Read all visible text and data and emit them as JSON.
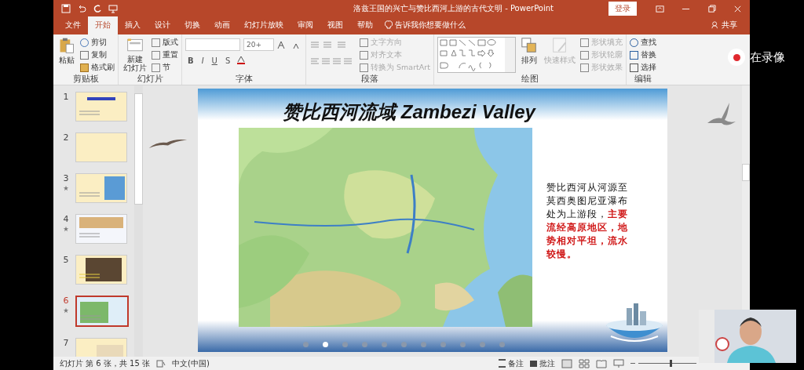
{
  "window": {
    "title": "洛兹王国的兴亡与赞比西河上游的古代文明 - PowerPoint",
    "login": "登录"
  },
  "tabs": [
    {
      "label": "文件",
      "selected": false
    },
    {
      "label": "开始",
      "selected": true
    },
    {
      "label": "插入",
      "selected": false
    },
    {
      "label": "设计",
      "selected": false
    },
    {
      "label": "切换",
      "selected": false
    },
    {
      "label": "动画",
      "selected": false
    },
    {
      "label": "幻灯片放映",
      "selected": false
    },
    {
      "label": "审阅",
      "selected": false
    },
    {
      "label": "视图",
      "selected": false
    },
    {
      "label": "帮助",
      "selected": false
    }
  ],
  "tell_me": "告诉我你想要做什么",
  "share": "共享",
  "ribbon": {
    "clipboard": {
      "label": "剪贴板",
      "paste": "粘贴",
      "items": [
        {
          "label": "剪切",
          "disabled": false
        },
        {
          "label": "复制",
          "disabled": false
        },
        {
          "label": "格式刷",
          "disabled": false
        }
      ]
    },
    "slides": {
      "label": "幻灯片",
      "new_slide": [
        "新建",
        "幻灯片"
      ],
      "items": [
        {
          "label": "版式",
          "disabled": false
        },
        {
          "label": "重置",
          "disabled": false
        },
        {
          "label": "节",
          "disabled": false
        }
      ]
    },
    "font": {
      "label": "字体",
      "size": "20+",
      "format_buttons": [
        "B",
        "I",
        "U",
        "S"
      ]
    },
    "paragraph": {
      "label": "段落",
      "items": [
        {
          "label": "文字方向",
          "disabled": true
        },
        {
          "label": "对齐文本",
          "disabled": true
        },
        {
          "label": "转换为 SmartArt",
          "disabled": true
        }
      ]
    },
    "drawing": {
      "label": "绘图",
      "arrange": {
        "label": "排列",
        "disabled": false
      },
      "quick_styles": {
        "label": "快速样式",
        "disabled": true
      },
      "items": [
        {
          "label": "形状填充",
          "disabled": true
        },
        {
          "label": "形状轮廓",
          "disabled": true
        },
        {
          "label": "形状效果",
          "disabled": true
        }
      ]
    },
    "editing": {
      "label": "编辑",
      "items": [
        {
          "label": "查找",
          "disabled": false
        },
        {
          "label": "替换",
          "disabled": false
        },
        {
          "label": "选择",
          "disabled": false
        }
      ]
    }
  },
  "slide_pane": [
    {
      "number": "1",
      "animated": false,
      "selected": false
    },
    {
      "number": "2",
      "animated": false,
      "selected": false
    },
    {
      "number": "3",
      "animated": true,
      "selected": false
    },
    {
      "number": "4",
      "animated": true,
      "selected": false
    },
    {
      "number": "5",
      "animated": false,
      "selected": false
    },
    {
      "number": "6",
      "animated": true,
      "selected": true
    },
    {
      "number": "7",
      "animated": false,
      "selected": false
    }
  ],
  "slide": {
    "title": "赞比西河流域 Zambezi Valley",
    "body": "赞比西河从河源至莫西奥图尼亚瀑布处为上游段，**主要流经高原地区，地势相对平坦，流水较慢。**",
    "nav_dots": [
      {
        "selected": false
      },
      {
        "selected": true
      },
      {
        "selected": false
      },
      {
        "selected": false
      },
      {
        "selected": false
      },
      {
        "selected": false
      },
      {
        "selected": false
      },
      {
        "selected": false
      },
      {
        "selected": false
      },
      {
        "selected": false
      },
      {
        "selected": false
      }
    ]
  },
  "status_bar": {
    "slide_info": "幻灯片 第 6 张，共 15 张",
    "language": "中文(中国)",
    "notes": "备注",
    "comments": "批注",
    "zoom": {
      "level": 0.55
    }
  },
  "recording": {
    "label": "在录像"
  }
}
